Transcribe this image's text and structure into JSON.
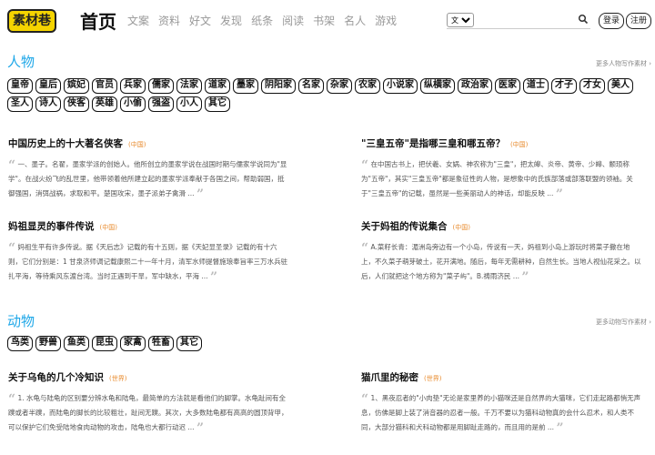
{
  "header": {
    "logo": "素材巷",
    "home": "首页",
    "nav": [
      "文案",
      "资料",
      "好文",
      "发现",
      "纸条",
      "阅读",
      "书架",
      "名人",
      "游戏"
    ],
    "search": {
      "select_value": "文案",
      "placeholder": ""
    },
    "login": "登录",
    "register": "注册"
  },
  "people": {
    "title": "人物",
    "more": "更多人物写作素材 ›",
    "tags": [
      "皇帝",
      "皇后",
      "嫔妃",
      "官员",
      "兵家",
      "儒家",
      "法家",
      "道家",
      "墨家",
      "阴阳家",
      "名家",
      "杂家",
      "农家",
      "小说家",
      "纵横家",
      "政治家",
      "医家",
      "道士",
      "才子",
      "才女",
      "美人",
      "圣人",
      "诗人",
      "侠客",
      "英雄",
      "小偷",
      "强盗",
      "小人",
      "其它"
    ],
    "cards": [
      {
        "title": "中国历史上的十大著名侠客",
        "category": "(中国)",
        "excerpt": "一、墨子。名翟，墨家学派的创始人。他所创立的墨家学说在战国时期与儒家学说同为\"显学\"。在战火纷飞的乱世里，他带领着他所建立起的墨家学派奉献于各国之间，帮助弱国，抵御强国，消弭战祸，求取和平。楚国攻宋，墨子派弟子禽滑 ..."
      },
      {
        "title": "\"三皇五帝\"是指哪三皇和哪五帝？",
        "category": "(中国)",
        "excerpt": "在中国古书上，把伏羲、女娲、神农称为\"三皇\"，把太皞、炎帝、黄帝、少皞、颛顼称为\"五帝\"，其实\"三皇五帝\"都是象征性的人物，是想象中的氏族部落或部落联盟的领袖。关于\"三皇五帝\"的记载，虽然是一些美丽动人的神话，却能反映 ..."
      },
      {
        "title": "妈祖显灵的事件传说",
        "category": "(中国)",
        "excerpt": "妈祖生平有许多传说。据《天后志》记载的有十五则，据《天妃显圣录》记载的有十六则，它们分别是：1 甘泉济师调记载康熙二十一年十月，清军水师提督施琅奉旨率三万水兵驻扎平海，等待乘风东渡台湾。当时正遇到干旱，军中缺水，平海 ..."
      },
      {
        "title": "关于妈祖的传说集合",
        "category": "(中国)",
        "excerpt": "A.菜籽长青：湄洲岛旁边有一个小岛，传说有一天，妈祖到小岛上游玩时将菜子撒在地上，不久菜子萌芽破土，花开满地。随后，每年无需耕种，自然生长。当地人视仙花采之。以后，人们就把这个地方称为\"菜子屿\"。B.祷雨济民 ..."
      }
    ]
  },
  "animals": {
    "title": "动物",
    "more": "更多动物写作素材 ›",
    "tags": [
      "鸟类",
      "野兽",
      "鱼类",
      "昆虫",
      "家禽",
      "牲畜",
      "其它"
    ],
    "cards": [
      {
        "title": "关于乌龟的几个冷知识",
        "category": "(世界)",
        "excerpt": "1. 水龟与陆龟的区别要分辨水龟和陆龟，最简单的方法就是看他们的脚掌。水龟趾间有全蹼或者半蹼，而陆龟的脚长的比较粗壮，趾间无蹼。其次，大多数陆龟都有高高的圆顶背甲，可以保护它们免受陆地食肉动物的攻击，陆龟也大都行动迟 ..."
      },
      {
        "title": "猫爪里的秘密",
        "category": "(世界)",
        "excerpt": "1、黑夜忍者的\"小肉垫\"无论是家里养的小猫咪还是自然界的大猫咪，它们走起路都悄无声息，仿佛是脚上装了消音器的忍者一般。千万不要以为猫科动物真的会什么忍术，和人类不同，大部分猫科和犬科动物都是用脚趾走路的，而且用的是前 ..."
      }
    ]
  }
}
